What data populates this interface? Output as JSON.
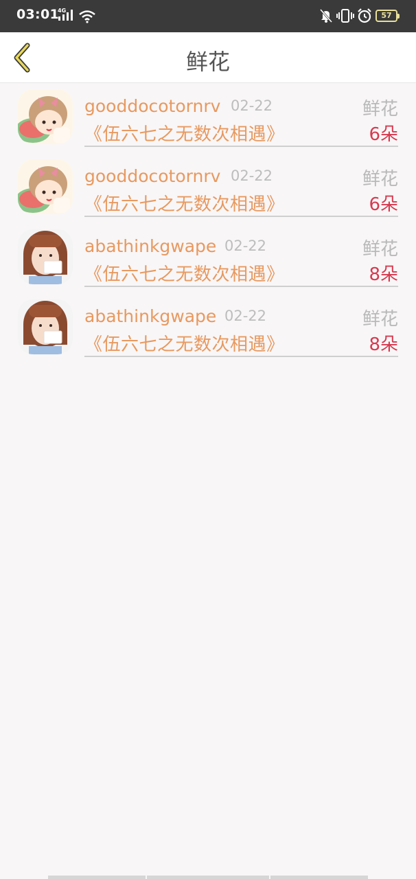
{
  "status_bar": {
    "time": "03:01",
    "network": "4G",
    "battery": "57",
    "icons": [
      "signal-icon",
      "wifi-icon",
      "mute-icon",
      "vibrate-icon",
      "alarm-icon",
      "battery-icon"
    ]
  },
  "header": {
    "title": "鲜花",
    "back_icon": "chevron-left-icon"
  },
  "colors": {
    "accent": "#e8995f",
    "count": "#d63a4f",
    "muted": "#bdbdbd",
    "back_chevron": "#e9d85a"
  },
  "list": [
    {
      "username": "gooddocotornrv",
      "date": "02-22",
      "gift_type": "鲜花",
      "book": "《伍六七之无数次相遇》",
      "count": "6朵",
      "avatar": "cartoon-girl-avatar"
    },
    {
      "username": "gooddocotornrv",
      "date": "02-22",
      "gift_type": "鲜花",
      "book": "《伍六七之无数次相遇》",
      "count": "6朵",
      "avatar": "cartoon-girl-avatar"
    },
    {
      "username": "abathinkgwape",
      "date": "02-22",
      "gift_type": "鲜花",
      "book": "《伍六七之无数次相遇》",
      "count": "8朵",
      "avatar": "photo-girl-avatar"
    },
    {
      "username": "abathinkgwape",
      "date": "02-22",
      "gift_type": "鲜花",
      "book": "《伍六七之无数次相遇》",
      "count": "8朵",
      "avatar": "photo-girl-avatar"
    }
  ]
}
